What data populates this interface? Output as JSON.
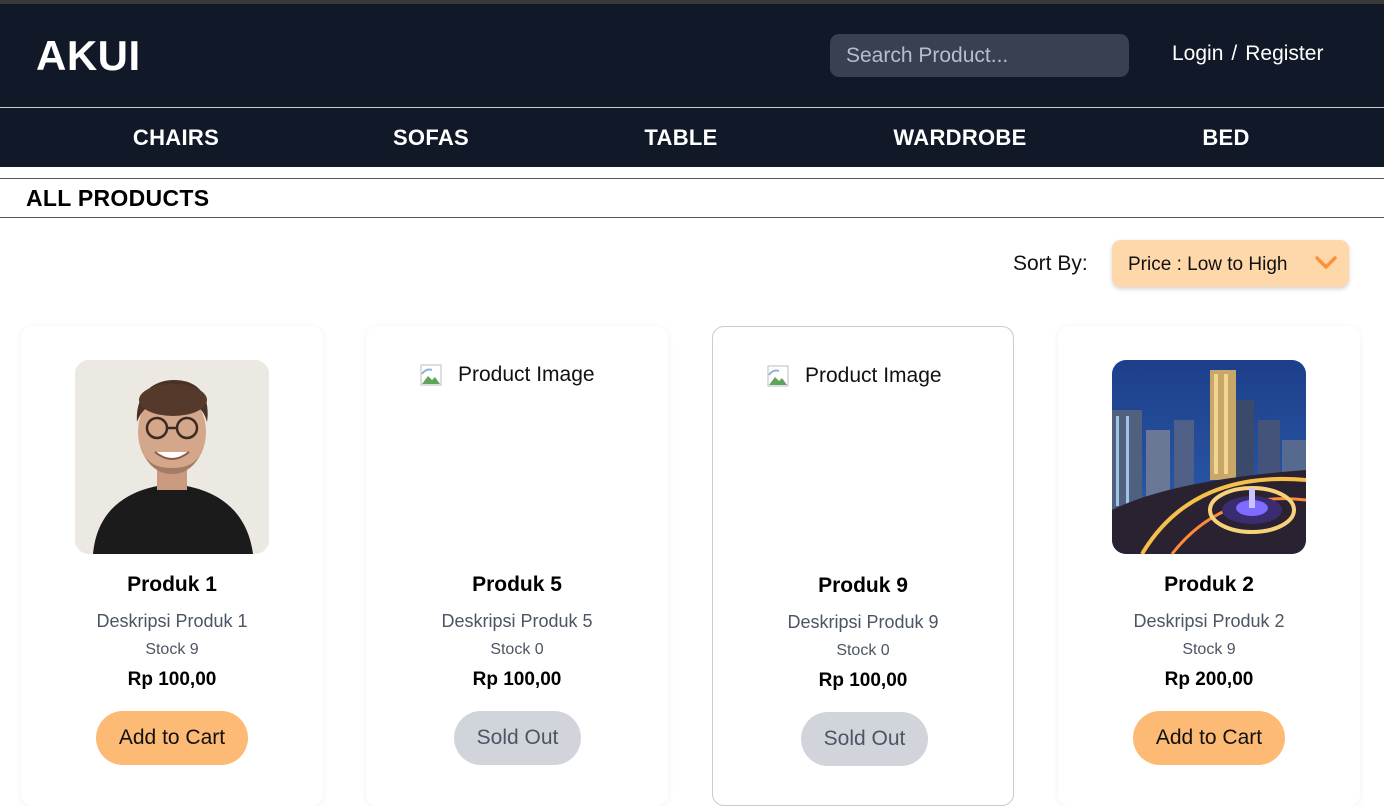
{
  "brand": "AKUI",
  "search": {
    "placeholder": "Search Product..."
  },
  "auth": {
    "login": "Login",
    "separator": "/",
    "register": "Register"
  },
  "categories": [
    "CHAIRS",
    "SOFAS",
    "TABLE",
    "WARDROBE",
    "BED"
  ],
  "section_title": "ALL PRODUCTS",
  "sort": {
    "label": "Sort By:",
    "selected": "Price : Low to High",
    "icon": "chevron-down-icon"
  },
  "products": [
    {
      "name": "Produk 1",
      "description": "Deskripsi Produk 1",
      "stock": "Stock 9",
      "price": "Rp 100,00",
      "action": "Add to Cart",
      "image": "portrait-photo"
    },
    {
      "name": "Produk 5",
      "description": "Deskripsi Produk 5",
      "stock": "Stock 0",
      "price": "Rp 100,00",
      "action": "Sold Out",
      "image_alt": "Product Image"
    },
    {
      "name": "Produk 9",
      "description": "Deskripsi Produk 9",
      "stock": "Stock 0",
      "price": "Rp 100,00",
      "action": "Sold Out",
      "image_alt": "Product Image"
    },
    {
      "name": "Produk 2",
      "description": "Deskripsi Produk 2",
      "stock": "Stock 9",
      "price": "Rp 200,00",
      "action": "Add to Cart",
      "image": "city-night-photo"
    }
  ],
  "colors": {
    "header_bg": "#111827",
    "search_bg": "#374151",
    "sort_bg": "#fed7aa",
    "add_button": "#fdba74",
    "sold_button": "#d1d5db",
    "chevron": "#fb923c"
  }
}
